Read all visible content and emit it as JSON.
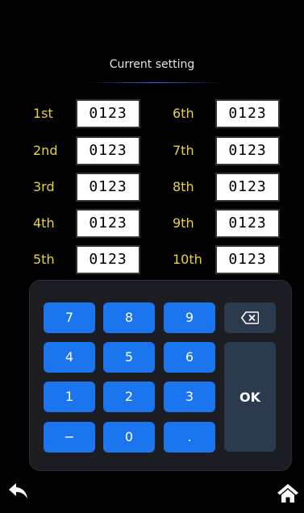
{
  "screen": {
    "title": "Current setting"
  },
  "settings": {
    "left": [
      {
        "label": "1st",
        "value": "0123"
      },
      {
        "label": "2nd",
        "value": "0123"
      },
      {
        "label": "3rd",
        "value": "0123"
      },
      {
        "label": "4th",
        "value": "0123"
      },
      {
        "label": "5th",
        "value": "0123"
      }
    ],
    "right": [
      {
        "label": "6th",
        "value": "0123"
      },
      {
        "label": "7th",
        "value": "0123"
      },
      {
        "label": "8th",
        "value": "0123"
      },
      {
        "label": "9th",
        "value": "0123"
      },
      {
        "label": "10th",
        "value": "0123"
      }
    ]
  },
  "keypad": {
    "keys": [
      "7",
      "8",
      "9",
      "4",
      "5",
      "6",
      "1",
      "2",
      "3",
      "−",
      "0",
      "."
    ],
    "backspace_icon": "backspace-icon",
    "ok_label": "OK"
  },
  "nav": {
    "back_icon": "back-arrow-icon",
    "home_icon": "home-icon"
  },
  "colors": {
    "label": "#e9d23a",
    "key_blue": "#1a75ee",
    "key_dark": "#2c3a4d",
    "panel": "#1b1d22",
    "title_underline": "#3c78ff"
  }
}
